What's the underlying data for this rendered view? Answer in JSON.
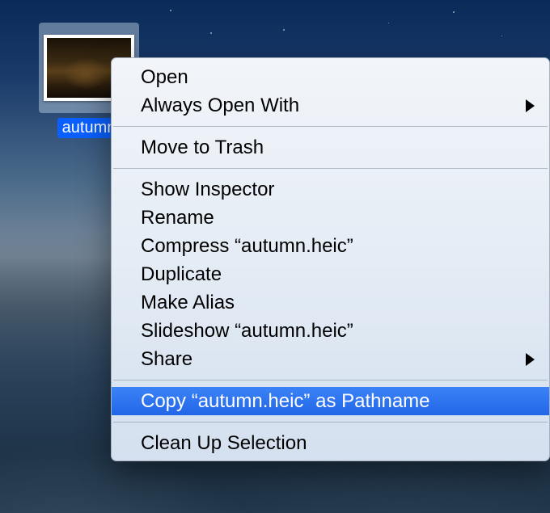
{
  "file": {
    "label": "autumn.heic",
    "label_truncated": "autumn"
  },
  "context_menu": {
    "groups": [
      [
        {
          "key": "open",
          "label": "Open",
          "submenu": false
        },
        {
          "key": "always-open-with",
          "label": "Always Open With",
          "submenu": true
        }
      ],
      [
        {
          "key": "move-to-trash",
          "label": "Move to Trash",
          "submenu": false
        }
      ],
      [
        {
          "key": "show-inspector",
          "label": "Show Inspector",
          "submenu": false
        },
        {
          "key": "rename",
          "label": "Rename",
          "submenu": false
        },
        {
          "key": "compress",
          "label": "Compress “autumn.heic”",
          "submenu": false
        },
        {
          "key": "duplicate",
          "label": "Duplicate",
          "submenu": false
        },
        {
          "key": "make-alias",
          "label": "Make Alias",
          "submenu": false
        },
        {
          "key": "slideshow",
          "label": "Slideshow “autumn.heic”",
          "submenu": false
        },
        {
          "key": "share",
          "label": "Share",
          "submenu": true
        }
      ],
      [
        {
          "key": "copy-as-pathname",
          "label": "Copy “autumn.heic” as Pathname",
          "submenu": false,
          "highlighted": true
        }
      ],
      [
        {
          "key": "clean-up-selection",
          "label": "Clean Up Selection",
          "submenu": false
        }
      ]
    ]
  }
}
